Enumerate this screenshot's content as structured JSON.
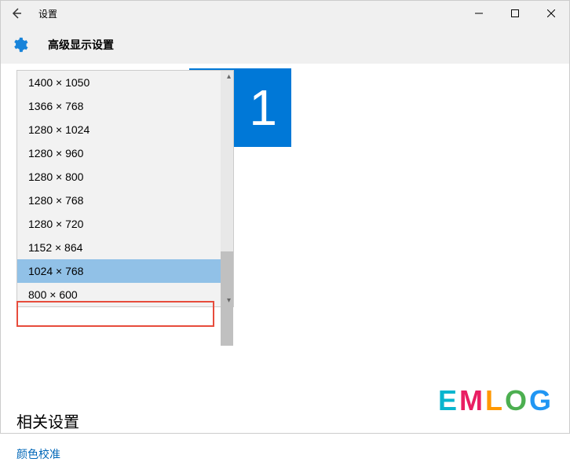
{
  "titlebar": {
    "title": "设置"
  },
  "subheader": {
    "title": "高级显示设置"
  },
  "display": {
    "number": "1"
  },
  "resolution_dropdown": {
    "items": [
      "1400 × 1050",
      "1366 × 768",
      "1280 × 1024",
      "1280 × 960",
      "1280 × 800",
      "1280 × 768",
      "1280 × 720",
      "1152 × 864",
      "1024 × 768",
      "800 × 600"
    ],
    "selected_index": 8
  },
  "related": {
    "title": "相关设置",
    "link": "颜色校准"
  },
  "watermark": {
    "e": "E",
    "m": "M",
    "l": "L",
    "o": "O",
    "g": "G"
  }
}
